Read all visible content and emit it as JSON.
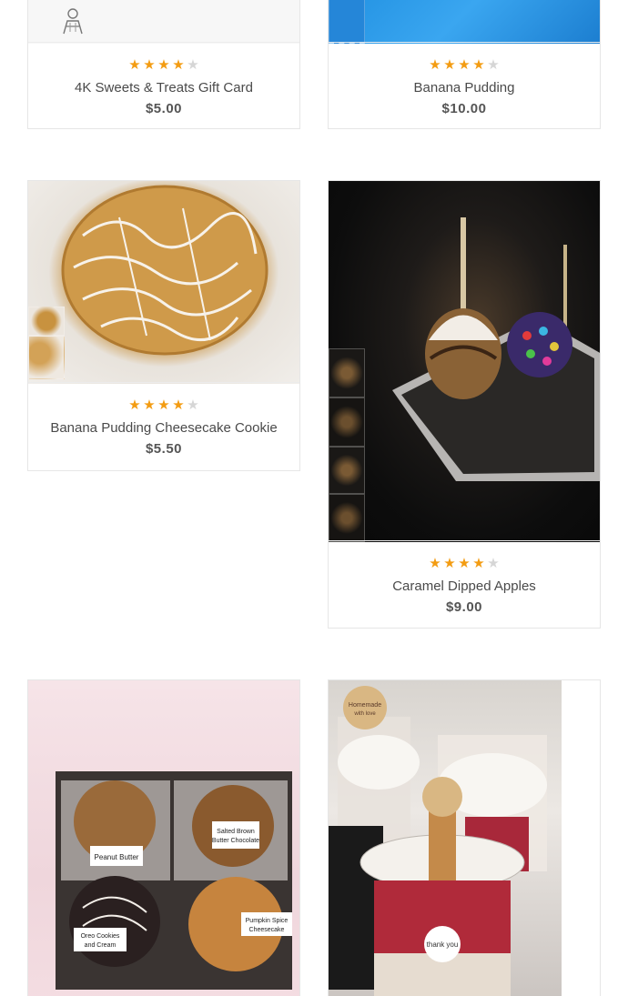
{
  "colors": {
    "star_on": "#f39c12",
    "star_off": "#d6d6d6",
    "border": "#e6e6e6"
  },
  "products": [
    {
      "id": "gift-card",
      "title": "4K Sweets & Treats Gift Card",
      "price": "$5.00",
      "rating": 4,
      "max_rating": 5,
      "image_alt": "gift card logo"
    },
    {
      "id": "banana-pudding",
      "title": "Banana Pudding",
      "price": "$10.00",
      "rating": 4,
      "max_rating": 5,
      "image_alt": "banana pudding photo"
    },
    {
      "id": "banana-pudding-cookie",
      "title": "Banana Pudding Cheesecake Cookie",
      "price": "$5.50",
      "rating": 4,
      "max_rating": 5,
      "image_alt": "cookie photo"
    },
    {
      "id": "caramel-apples",
      "title": "Caramel Dipped Apples",
      "price": "$9.00",
      "rating": 4,
      "max_rating": 5,
      "image_alt": "caramel apple photo"
    },
    {
      "id": "cookie-box",
      "title": "",
      "price": "",
      "rating": null,
      "image_alt": "cookie box photo"
    },
    {
      "id": "dessert-cups",
      "title": "",
      "price": "",
      "rating": null,
      "image_alt": "dessert cups photo"
    }
  ],
  "image_labels": {
    "peanut_butter": "Peanut Butter",
    "salted_brown": "Salted Brown",
    "butter_chocolate": "Butter Chocolate",
    "oreo": "Oreo Cookies",
    "and_cream": "and Cream",
    "pumpkin": "Pumpkin Spice",
    "cheesecake": "Cheesecake",
    "homemade": "Homemade",
    "with_love": "with love",
    "thank_you": "thank you"
  }
}
